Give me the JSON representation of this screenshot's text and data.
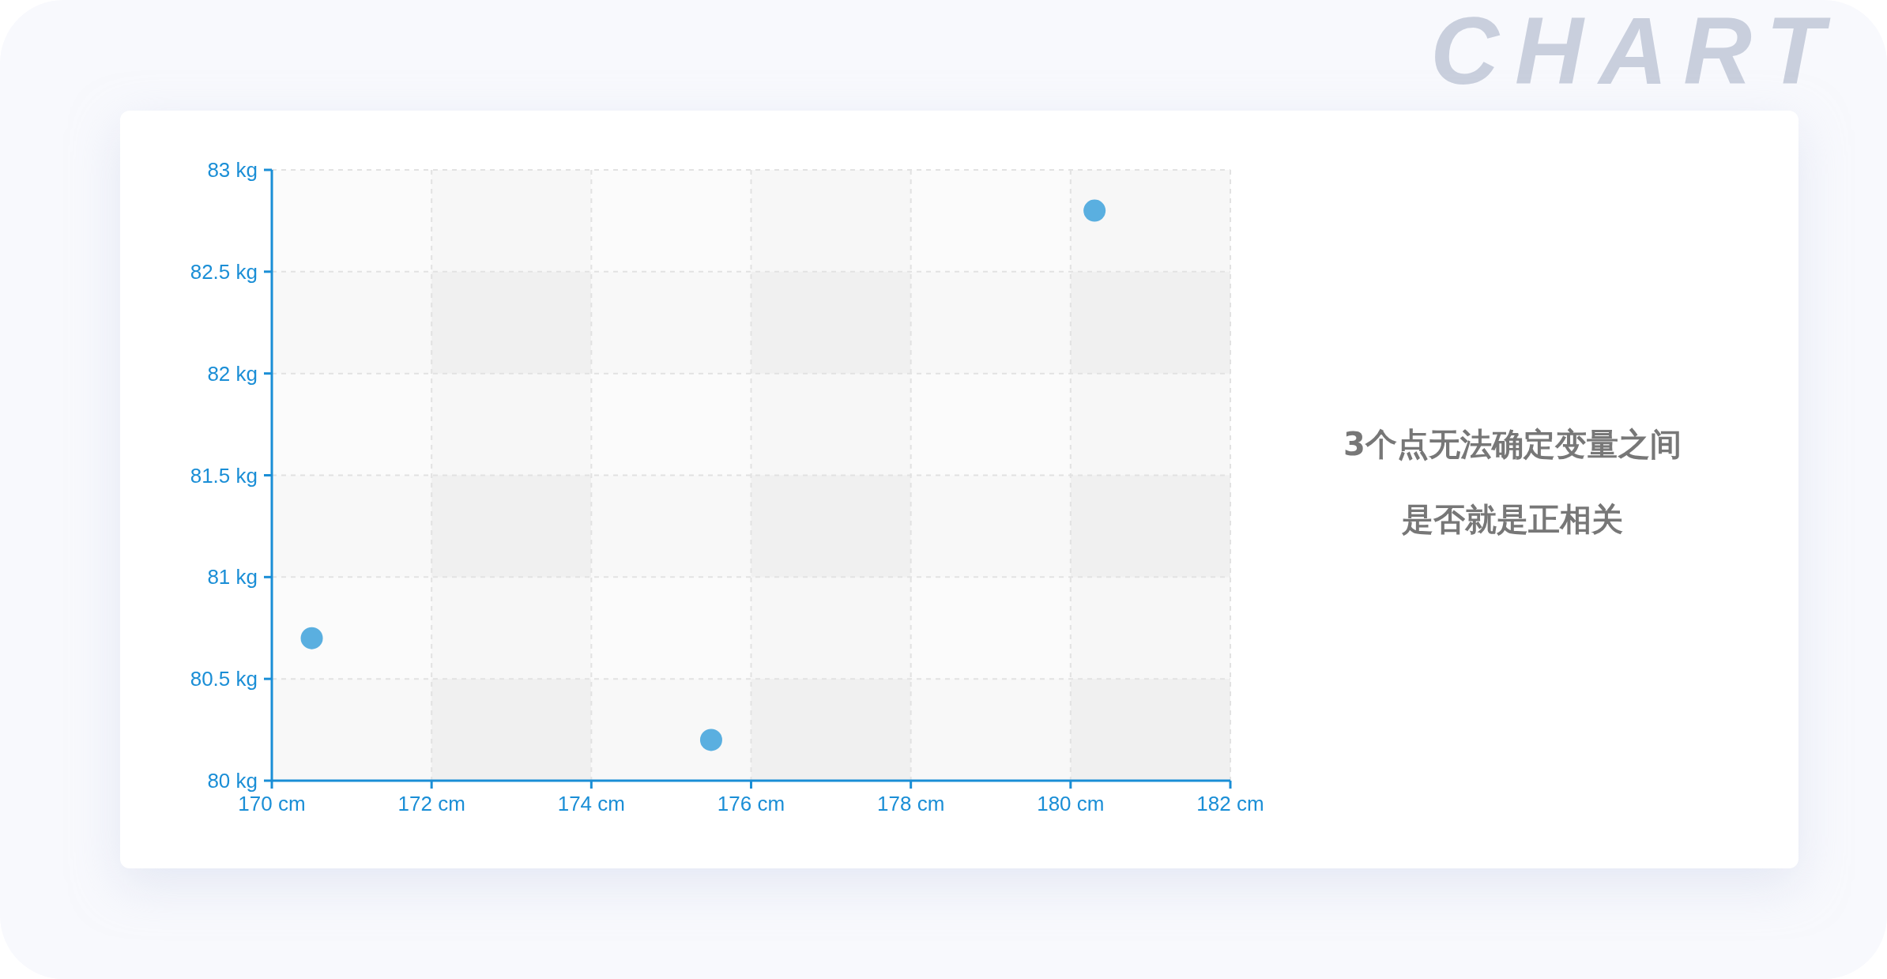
{
  "background_title": "CHART",
  "card": {
    "chart_data": {
      "type": "scatter",
      "grid": true,
      "x": [
        170.5,
        175.5,
        180.3
      ],
      "series": [
        {
          "color": "#5aafe0",
          "values": [
            80.7,
            80.2,
            82.8
          ]
        }
      ],
      "xlim": [
        170,
        182
      ],
      "ylim": [
        80,
        83
      ],
      "xticks": [
        {
          "value": 170,
          "label": "170 cm"
        },
        {
          "value": 172,
          "label": "172 cm"
        },
        {
          "value": 174,
          "label": "174 cm"
        },
        {
          "value": 176,
          "label": "176 cm"
        },
        {
          "value": 178,
          "label": "178 cm"
        },
        {
          "value": 180,
          "label": "180 cm"
        },
        {
          "value": 182,
          "label": "182 cm"
        }
      ],
      "yticks": [
        {
          "value": 80,
          "label": "80 kg"
        },
        {
          "value": 80.5,
          "label": "80.5 kg"
        },
        {
          "value": 81,
          "label": "81 kg"
        },
        {
          "value": 81.5,
          "label": "81.5 kg"
        },
        {
          "value": 82,
          "label": "82 kg"
        },
        {
          "value": 82.5,
          "label": "82.5 kg"
        },
        {
          "value": 83,
          "label": "83 kg"
        }
      ]
    },
    "note_lines": [
      "3个点无法确定变量之间",
      "是否就是正相关"
    ]
  }
}
